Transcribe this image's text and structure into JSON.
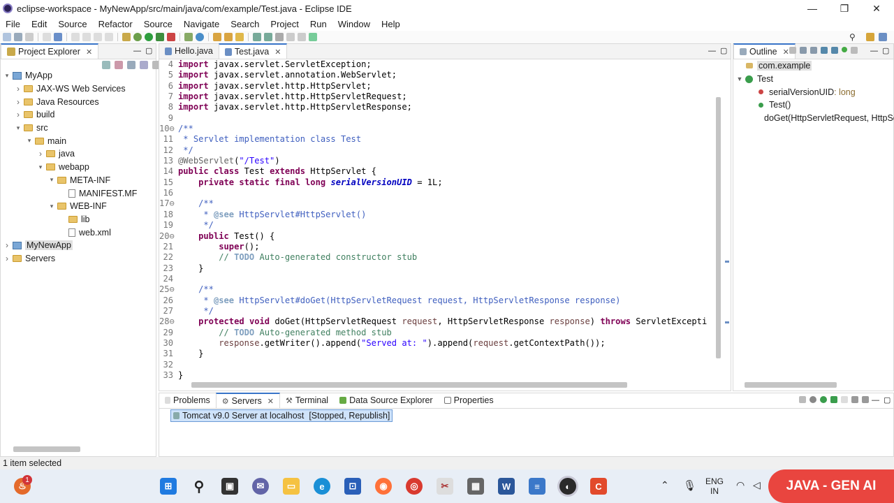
{
  "window": {
    "title": "eclipse-workspace - MyNewApp/src/main/java/com/example/Test.java - Eclipse IDE",
    "controls": [
      "—",
      "❐",
      "✕"
    ]
  },
  "menu": [
    "File",
    "Edit",
    "Source",
    "Refactor",
    "Source",
    "Navigate",
    "Search",
    "Project",
    "Run",
    "Window",
    "Help"
  ],
  "project_explorer": {
    "tab_label": "Project Explorer",
    "tree": [
      {
        "label": "MyApp",
        "depth": 0,
        "kind": "project",
        "expanded": true
      },
      {
        "label": "JAX-WS Web Services",
        "depth": 1,
        "kind": "node",
        "expanded": false
      },
      {
        "label": "Java Resources",
        "depth": 1,
        "kind": "node",
        "expanded": false
      },
      {
        "label": "build",
        "depth": 1,
        "kind": "folder",
        "expanded": false
      },
      {
        "label": "src",
        "depth": 1,
        "kind": "folder",
        "expanded": true
      },
      {
        "label": "main",
        "depth": 2,
        "kind": "folder",
        "expanded": true
      },
      {
        "label": "java",
        "depth": 3,
        "kind": "folder",
        "expanded": false
      },
      {
        "label": "webapp",
        "depth": 3,
        "kind": "folder",
        "expanded": true
      },
      {
        "label": "META-INF",
        "depth": 4,
        "kind": "folder",
        "expanded": true
      },
      {
        "label": "MANIFEST.MF",
        "depth": 5,
        "kind": "file"
      },
      {
        "label": "WEB-INF",
        "depth": 4,
        "kind": "folder",
        "expanded": true
      },
      {
        "label": "lib",
        "depth": 5,
        "kind": "folder"
      },
      {
        "label": "web.xml",
        "depth": 5,
        "kind": "file"
      },
      {
        "label": "MyNewApp",
        "depth": 0,
        "kind": "project",
        "expanded": false,
        "selected": true
      },
      {
        "label": "Servers",
        "depth": 0,
        "kind": "folder",
        "expanded": false
      }
    ]
  },
  "editor": {
    "tabs": [
      {
        "label": "Hello.java",
        "active": false
      },
      {
        "label": "Test.java",
        "active": true
      }
    ],
    "lines": [
      {
        "n": "4",
        "code": "import javax.servlet.ServletException;"
      },
      {
        "n": "5",
        "code": "import javax.servlet.annotation.WebServlet;"
      },
      {
        "n": "6",
        "code": "import javax.servlet.http.HttpServlet;"
      },
      {
        "n": "7",
        "code": "import javax.servlet.http.HttpServletRequest;"
      },
      {
        "n": "8",
        "code": "import javax.servlet.http.HttpServletResponse;"
      },
      {
        "n": "9",
        "code": ""
      },
      {
        "n": "10⊖",
        "code": "/**"
      },
      {
        "n": "11",
        "code": " * Servlet implementation class Test"
      },
      {
        "n": "12",
        "code": " */"
      },
      {
        "n": "13",
        "code": "@WebServlet(\"/Test\")"
      },
      {
        "n": "14",
        "code": "public class Test extends HttpServlet {"
      },
      {
        "n": "15",
        "code": "    private static final long serialVersionUID = 1L;"
      },
      {
        "n": "16",
        "code": ""
      },
      {
        "n": "17⊖",
        "code": "    /**"
      },
      {
        "n": "18",
        "code": "     * @see HttpServlet#HttpServlet()"
      },
      {
        "n": "19",
        "code": "     */"
      },
      {
        "n": "20⊖",
        "code": "    public Test() {"
      },
      {
        "n": "21",
        "code": "        super();"
      },
      {
        "n": "22",
        "code": "        // TODO Auto-generated constructor stub"
      },
      {
        "n": "23",
        "code": "    }"
      },
      {
        "n": "24",
        "code": ""
      },
      {
        "n": "25⊖",
        "code": "    /**"
      },
      {
        "n": "26",
        "code": "     * @see HttpServlet#doGet(HttpServletRequest request, HttpServletResponse response)"
      },
      {
        "n": "27",
        "code": "     */"
      },
      {
        "n": "28⊖",
        "code": "    protected void doGet(HttpServletRequest request, HttpServletResponse response) throws ServletExcepti"
      },
      {
        "n": "29",
        "code": "        // TODO Auto-generated method stub"
      },
      {
        "n": "30",
        "code": "        response.getWriter().append(\"Served at: \").append(request.getContextPath());"
      },
      {
        "n": "31",
        "code": "    }"
      },
      {
        "n": "32",
        "code": ""
      },
      {
        "n": "33",
        "code": "}"
      }
    ]
  },
  "outline": {
    "tab_label": "Outline",
    "items": [
      {
        "label": "com.example",
        "depth": 0
      },
      {
        "label": "Test",
        "depth": 0
      },
      {
        "label": "serialVersionUID",
        "suffix": " : long",
        "depth": 1
      },
      {
        "label": "Test()",
        "depth": 1
      },
      {
        "label": "doGet(HttpServletRequest, HttpSe",
        "depth": 1
      }
    ]
  },
  "bottom": {
    "tabs": [
      {
        "label": "Problems",
        "active": false
      },
      {
        "label": "Servers",
        "active": true
      },
      {
        "label": "Terminal",
        "active": false
      },
      {
        "label": "Data Source Explorer",
        "active": false
      },
      {
        "label": "Properties",
        "active": false
      }
    ],
    "server_entry": "Tomcat v9.0 Server at localhost  [Stopped, Republish]"
  },
  "status": {
    "text": "1 item selected"
  },
  "taskbar": {
    "badge": "1",
    "lang_line1": "ENG",
    "lang_line2": "IN",
    "promo": "JAVA - GEN AI"
  }
}
